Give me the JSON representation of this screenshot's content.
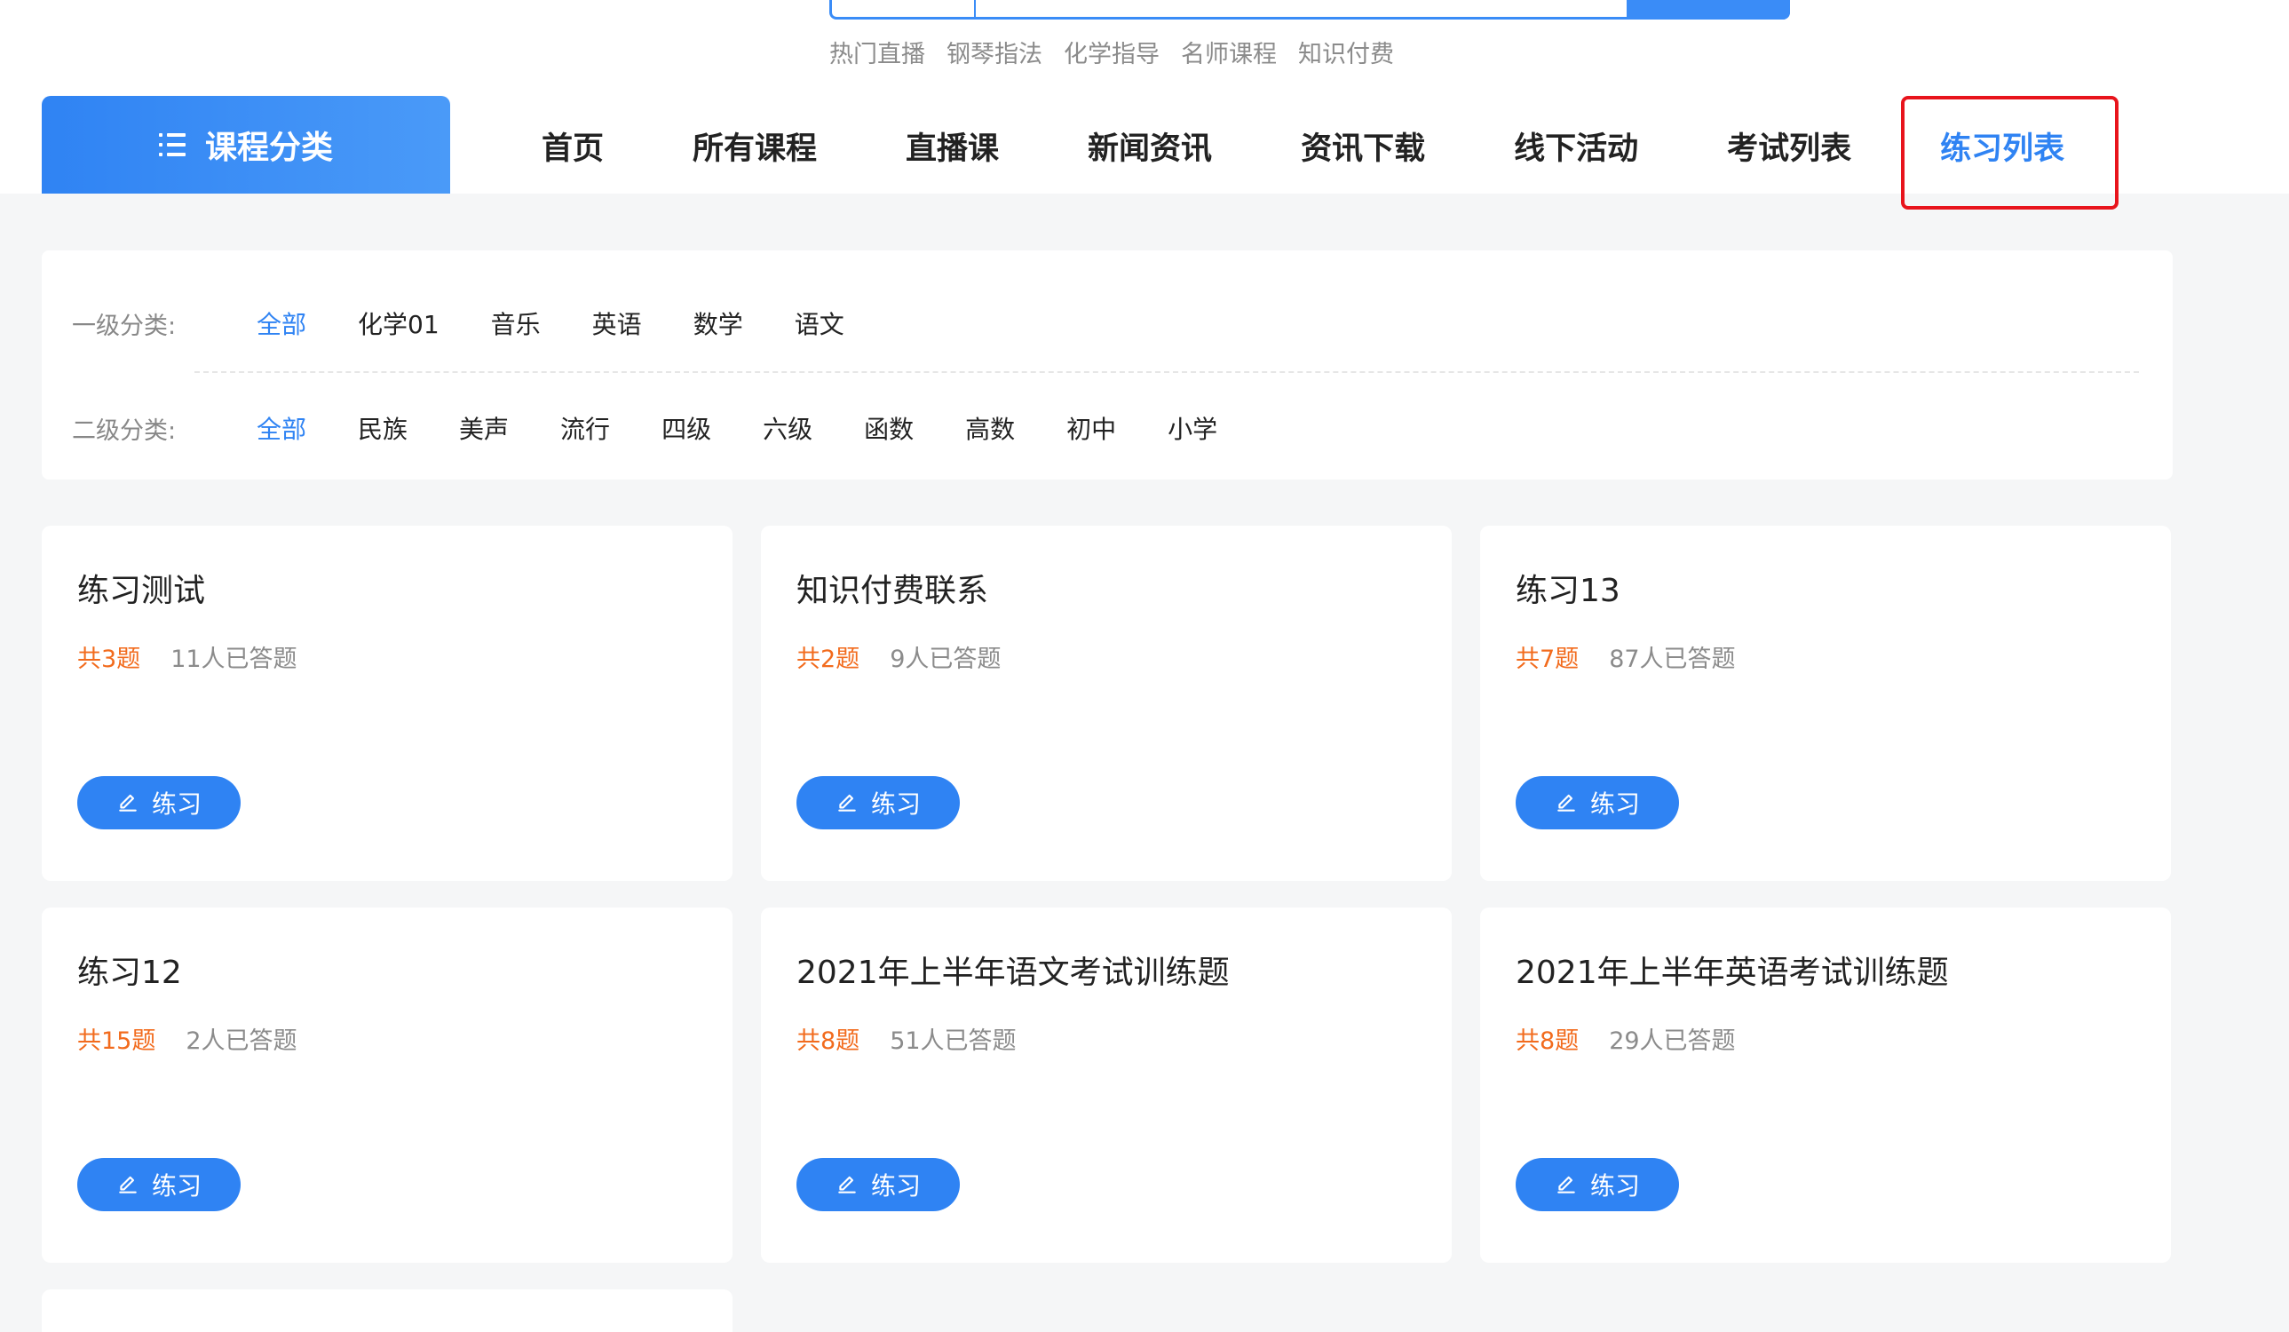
{
  "search": {
    "hot_links": [
      "热门直播",
      "钢琴指法",
      "化学指导",
      "名师课程",
      "知识付费"
    ]
  },
  "category_tab": {
    "label": "课程分类",
    "icon": "list-icon"
  },
  "nav": {
    "items": [
      "首页",
      "所有课程",
      "直播课",
      "新闻资讯",
      "资讯下载",
      "线下活动",
      "考试列表",
      "练习列表"
    ],
    "active_index": 7
  },
  "filters": {
    "level1": {
      "label": "一级分类:",
      "options": [
        "全部",
        "化学01",
        "音乐",
        "英语",
        "数学",
        "语文"
      ],
      "active": "全部"
    },
    "level2": {
      "label": "二级分类:",
      "options": [
        "全部",
        "民族",
        "美声",
        "流行",
        "四级",
        "六级",
        "函数",
        "高数",
        "初中",
        "小学"
      ],
      "active": "全部"
    }
  },
  "cards": [
    {
      "title": "练习测试",
      "count": "共3题",
      "answered": "11人已答题",
      "button": "练习"
    },
    {
      "title": "知识付费联系",
      "count": "共2题",
      "answered": "9人已答题",
      "button": "练习"
    },
    {
      "title": "练习13",
      "count": "共7题",
      "answered": "87人已答题",
      "button": "练习"
    },
    {
      "title": "练习12",
      "count": "共15题",
      "answered": "2人已答题",
      "button": "练习"
    },
    {
      "title": "2021年上半年语文考试训练题",
      "count": "共8题",
      "answered": "51人已答题",
      "button": "练习"
    },
    {
      "title": "2021年上半年英语考试训练题",
      "count": "共8题",
      "answered": "29人已答题",
      "button": "练习"
    }
  ],
  "colors": {
    "accent": "#2f83f3",
    "count": "#f26b1d",
    "highlight_border": "#e8141c",
    "page_bg": "#f5f6f7"
  }
}
